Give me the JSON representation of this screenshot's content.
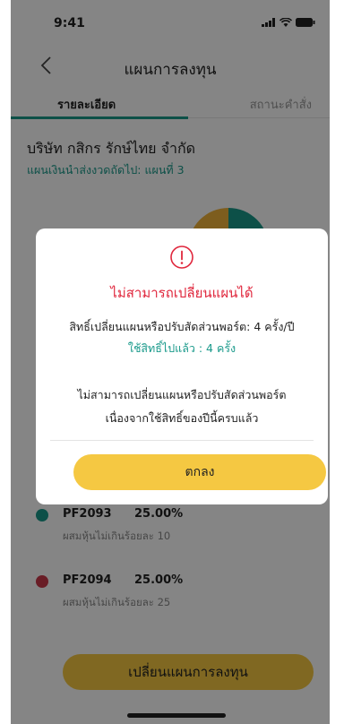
{
  "status_bar": {
    "time": "9:41"
  },
  "header": {
    "title": "แผนการลงทุน"
  },
  "tabs": [
    {
      "label": "รายละเอียด",
      "active": true
    },
    {
      "label": "สถานะคำสั่ง",
      "active": false
    }
  ],
  "company": {
    "name": "บริษัท กสิกร รักษ์ไทย จำกัด",
    "next_plan": "แผนเงินนำส่งงวดถัดไป: แผนที่ 3"
  },
  "funds": [
    {
      "code": "PF2093",
      "percent": "25.00%",
      "description": "ผสมหุ้นไม่เกินร้อยละ 10",
      "color": "#1a9a8b"
    },
    {
      "code": "PF2094",
      "percent": "25.00%",
      "description": "ผสมหุ้นไม่เกินร้อยละ 25",
      "color": "#c9394a"
    }
  ],
  "change_button": {
    "label": "เปลี่ยนแผนการลงทุน"
  },
  "modal": {
    "title": "ไม่สามารถเปลี่ยนแผนได้",
    "rights_line": "สิทธิ์เปลี่ยนแผนหรือปรับสัดส่วนพอร์ต: 4 ครั้ง/ปี",
    "used_line": "ใช้สิทธิ์ไปแล้ว : 4 ครั้ง",
    "message_line1": "ไม่สามารถเปลี่ยนแผนหรือปรับสัดส่วนพอร์ต",
    "message_line2": "เนื่องจากใช้สิทธิ์ของปีนี้ครบแล้ว",
    "ok_label": "ตกลง"
  },
  "colors": {
    "accent": "#1a9a8b",
    "warning": "#e0273d",
    "button": "#f5c842",
    "donut_yellow": "#f0b33a"
  }
}
